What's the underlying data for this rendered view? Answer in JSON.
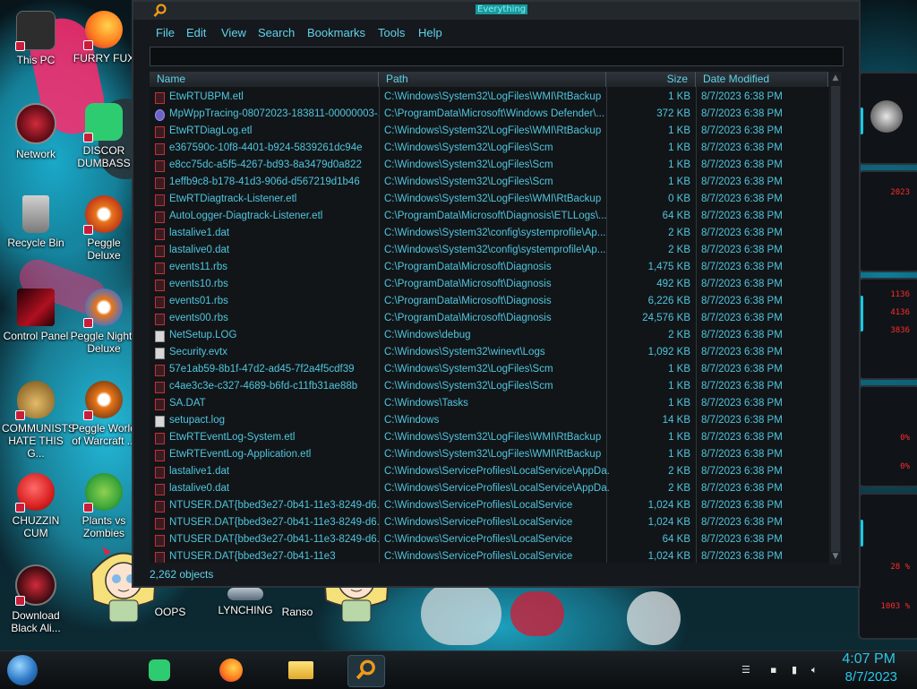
{
  "window": {
    "title": "Everything",
    "menu": [
      "File",
      "Edit",
      "View",
      "Search",
      "Bookmarks",
      "Tools",
      "Help"
    ],
    "search_value": "",
    "columns": [
      "Name",
      "Path",
      "Size",
      "Date Modified"
    ],
    "rows": [
      {
        "name": "EtwRTUBPM.etl",
        "path": "C:\\Windows\\System32\\LogFiles\\WMI\\RtBackup",
        "size": "1 KB",
        "date": "8/7/2023 6:38 PM",
        "icon": "etl-file-icon"
      },
      {
        "name": "MpWppTracing-08072023-183811-00000003-...",
        "path": "C:\\ProgramData\\Microsoft\\Windows Defender\\...",
        "size": "372 KB",
        "date": "8/7/2023 6:38 PM",
        "icon": "defender-file-icon"
      },
      {
        "name": "EtwRTDiagLog.etl",
        "path": "C:\\Windows\\System32\\LogFiles\\WMI\\RtBackup",
        "size": "1 KB",
        "date": "8/7/2023 6:38 PM",
        "icon": "etl-file-icon"
      },
      {
        "name": "e367590c-10f8-4401-b924-5839261dc94e",
        "path": "C:\\Windows\\System32\\LogFiles\\Scm",
        "size": "1 KB",
        "date": "8/7/2023 6:38 PM",
        "icon": "file-icon"
      },
      {
        "name": "e8cc75dc-a5f5-4267-bd93-8a3479d0a822",
        "path": "C:\\Windows\\System32\\LogFiles\\Scm",
        "size": "1 KB",
        "date": "8/7/2023 6:38 PM",
        "icon": "file-icon"
      },
      {
        "name": "1effb9c8-b178-41d3-906d-d567219d1b46",
        "path": "C:\\Windows\\System32\\LogFiles\\Scm",
        "size": "1 KB",
        "date": "8/7/2023 6:38 PM",
        "icon": "file-icon"
      },
      {
        "name": "EtwRTDiagtrack-Listener.etl",
        "path": "C:\\Windows\\System32\\LogFiles\\WMI\\RtBackup",
        "size": "0 KB",
        "date": "8/7/2023 6:38 PM",
        "icon": "etl-file-icon"
      },
      {
        "name": "AutoLogger-Diagtrack-Listener.etl",
        "path": "C:\\ProgramData\\Microsoft\\Diagnosis\\ETLLogs\\...",
        "size": "64 KB",
        "date": "8/7/2023 6:38 PM",
        "icon": "etl-file-icon"
      },
      {
        "name": "lastalive1.dat",
        "path": "C:\\Windows\\System32\\config\\systemprofile\\Ap...",
        "size": "2 KB",
        "date": "8/7/2023 6:38 PM",
        "icon": "file-icon"
      },
      {
        "name": "lastalive0.dat",
        "path": "C:\\Windows\\System32\\config\\systemprofile\\Ap...",
        "size": "2 KB",
        "date": "8/7/2023 6:38 PM",
        "icon": "file-icon"
      },
      {
        "name": "events11.rbs",
        "path": "C:\\ProgramData\\Microsoft\\Diagnosis",
        "size": "1,475 KB",
        "date": "8/7/2023 6:38 PM",
        "icon": "file-icon"
      },
      {
        "name": "events10.rbs",
        "path": "C:\\ProgramData\\Microsoft\\Diagnosis",
        "size": "492 KB",
        "date": "8/7/2023 6:38 PM",
        "icon": "file-icon"
      },
      {
        "name": "events01.rbs",
        "path": "C:\\ProgramData\\Microsoft\\Diagnosis",
        "size": "6,226 KB",
        "date": "8/7/2023 6:38 PM",
        "icon": "file-icon"
      },
      {
        "name": "events00.rbs",
        "path": "C:\\ProgramData\\Microsoft\\Diagnosis",
        "size": "24,576 KB",
        "date": "8/7/2023 6:38 PM",
        "icon": "file-icon"
      },
      {
        "name": "NetSetup.LOG",
        "path": "C:\\Windows\\debug",
        "size": "2 KB",
        "date": "8/7/2023 6:38 PM",
        "icon": "text-file-icon"
      },
      {
        "name": "Security.evtx",
        "path": "C:\\Windows\\System32\\winevt\\Logs",
        "size": "1,092 KB",
        "date": "8/7/2023 6:38 PM",
        "icon": "event-log-icon"
      },
      {
        "name": "57e1ab59-8b1f-47d2-ad45-7f2a4f5cdf39",
        "path": "C:\\Windows\\System32\\LogFiles\\Scm",
        "size": "1 KB",
        "date": "8/7/2023 6:38 PM",
        "icon": "file-icon"
      },
      {
        "name": "c4ae3c3e-c327-4689-b6fd-c11fb31ae88b",
        "path": "C:\\Windows\\System32\\LogFiles\\Scm",
        "size": "1 KB",
        "date": "8/7/2023 6:38 PM",
        "icon": "file-icon"
      },
      {
        "name": "SA.DAT",
        "path": "C:\\Windows\\Tasks",
        "size": "1 KB",
        "date": "8/7/2023 6:38 PM",
        "icon": "file-icon"
      },
      {
        "name": "setupact.log",
        "path": "C:\\Windows",
        "size": "14 KB",
        "date": "8/7/2023 6:38 PM",
        "icon": "text-file-icon"
      },
      {
        "name": "EtwRTEventLog-System.etl",
        "path": "C:\\Windows\\System32\\LogFiles\\WMI\\RtBackup",
        "size": "1 KB",
        "date": "8/7/2023 6:38 PM",
        "icon": "etl-file-icon"
      },
      {
        "name": "EtwRTEventLog-Application.etl",
        "path": "C:\\Windows\\System32\\LogFiles\\WMI\\RtBackup",
        "size": "1 KB",
        "date": "8/7/2023 6:38 PM",
        "icon": "etl-file-icon"
      },
      {
        "name": "lastalive1.dat",
        "path": "C:\\Windows\\ServiceProfiles\\LocalService\\AppDa...",
        "size": "2 KB",
        "date": "8/7/2023 6:38 PM",
        "icon": "file-icon"
      },
      {
        "name": "lastalive0.dat",
        "path": "C:\\Windows\\ServiceProfiles\\LocalService\\AppDa...",
        "size": "2 KB",
        "date": "8/7/2023 6:38 PM",
        "icon": "file-icon"
      },
      {
        "name": "NTUSER.DAT{bbed3e27-0b41-11e3-8249-d6...",
        "path": "C:\\Windows\\ServiceProfiles\\LocalService",
        "size": "1,024 KB",
        "date": "8/7/2023 6:38 PM",
        "icon": "file-icon"
      },
      {
        "name": "NTUSER.DAT{bbed3e27-0b41-11e3-8249-d6...",
        "path": "C:\\Windows\\ServiceProfiles\\LocalService",
        "size": "1,024 KB",
        "date": "8/7/2023 6:38 PM",
        "icon": "file-icon"
      },
      {
        "name": "NTUSER.DAT{bbed3e27-0b41-11e3-8249-d6...",
        "path": "C:\\Windows\\ServiceProfiles\\LocalService",
        "size": "64 KB",
        "date": "8/7/2023 6:38 PM",
        "icon": "file-icon"
      },
      {
        "name": "NTUSER.DAT{bbed3e27-0b41-11e3",
        "path": "C:\\Windows\\ServiceProfiles\\LocalService",
        "size": "1,024 KB",
        "date": "8/7/2023 6:38 PM",
        "icon": "file-icon"
      }
    ],
    "status": "2,262 objects"
  },
  "desktop_icons": [
    {
      "label": "This PC",
      "icon": "computer-icon",
      "color": "#3a3a3a"
    },
    {
      "label": "FURRY FUX",
      "icon": "firefox-icon",
      "color": "#ff7b1c"
    },
    {
      "label": "Network",
      "icon": "network-icon",
      "color": "#8a1020"
    },
    {
      "label": "DISCOR DUMBASS",
      "icon": "chat-app-icon",
      "color": "#2ecc71"
    },
    {
      "label": "Recycle Bin",
      "icon": "recycle-bin-icon",
      "color": "#b0b0b0"
    },
    {
      "label": "Peggle Deluxe",
      "icon": "peggle-icon",
      "color": "#e8761a"
    },
    {
      "label": "Control Panel",
      "icon": "control-panel-icon",
      "color": "#b01020"
    },
    {
      "label": "Peggle Nights Deluxe",
      "icon": "peggle-nights-icon",
      "color": "#3a6fd8"
    },
    {
      "label": "COMMUNISTS HATE THIS G...",
      "icon": "money-bag-icon",
      "color": "#c89a3a"
    },
    {
      "label": "Peggle World of Warcraft ...",
      "icon": "peggle-wow-icon",
      "color": "#e8761a"
    },
    {
      "label": "CHUZZIN CUM",
      "icon": "chuzzle-icon",
      "color": "#d82020"
    },
    {
      "label": "Plants vs Zombies",
      "icon": "pvz-icon",
      "color": "#3aa63a"
    },
    {
      "label": "Download Black Ali...",
      "icon": "alienware-icon",
      "color": "#8a1020"
    },
    {
      "label": "OOPS",
      "icon": "oops-icon",
      "color": "#444"
    },
    {
      "label": "LYNCHING",
      "icon": "lynching-icon",
      "color": "#5a6a7a"
    },
    {
      "label": "Ranso",
      "icon": "ranso-icon",
      "color": "#444"
    }
  ],
  "side_widget": {
    "readouts": [
      "2023",
      "1136",
      "4136",
      "3836",
      "0%",
      "0%",
      "28 %",
      "1003 %"
    ]
  },
  "taskbar": {
    "apps": [
      "chat-app-icon",
      "firefox-icon",
      "file-explorer-icon",
      "everything-search-icon"
    ],
    "clock_time": "4:07 PM",
    "clock_date": "8/7/2023"
  }
}
